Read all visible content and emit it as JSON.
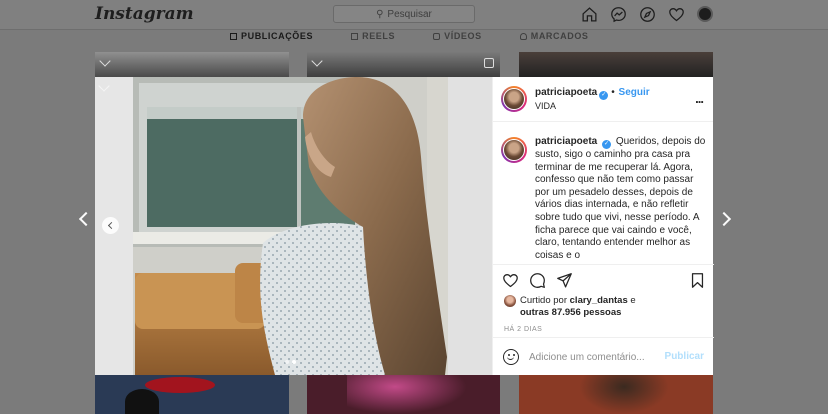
{
  "app": {
    "logo": "Instagram"
  },
  "search": {
    "placeholder": "Pesquisar"
  },
  "nav": {
    "icons": [
      "home-icon",
      "messenger-icon",
      "explore-icon",
      "heart-icon",
      "profile-avatar"
    ]
  },
  "profile_tabs": [
    {
      "label": "PUBLICAÇÕES",
      "icon": "grid-icon",
      "active": true
    },
    {
      "label": "REELS",
      "icon": "reels-icon",
      "active": false
    },
    {
      "label": "VÍDEOS",
      "icon": "video-icon",
      "active": false
    },
    {
      "label": "MARCADOS",
      "icon": "tagged-icon",
      "active": false
    }
  ],
  "post": {
    "username": "patriciapoeta",
    "verified": true,
    "follow_label": "Seguir",
    "separator": "•",
    "location": "VIDA",
    "more_label": "...",
    "caption": "Queridos, depois do susto, sigo o caminho pra casa pra terminar de me recuperar lá. Agora, confesso que não tem como passar por um pesadelo desses, depois de vários dias internada, e não refletir sobre tudo que vivi, nesse período. A ficha parece que vai caindo e você, claro, tentando entender melhor as coisas e o",
    "liked_by_prefix": "Curtido por",
    "liked_by_user": "clary_dantas",
    "liked_by_and": "e",
    "liked_by_others": "outras 87.956 pessoas",
    "time": "HÁ 2 DIAS",
    "comment_placeholder": "Adicione um comentário...",
    "publish_label": "Publicar",
    "carousel_dots": 2,
    "carousel_active": 1
  },
  "colors": {
    "accent": "#3897f0",
    "publish_disabled": "#b2dffc",
    "overlay": "#7b7b7b"
  }
}
